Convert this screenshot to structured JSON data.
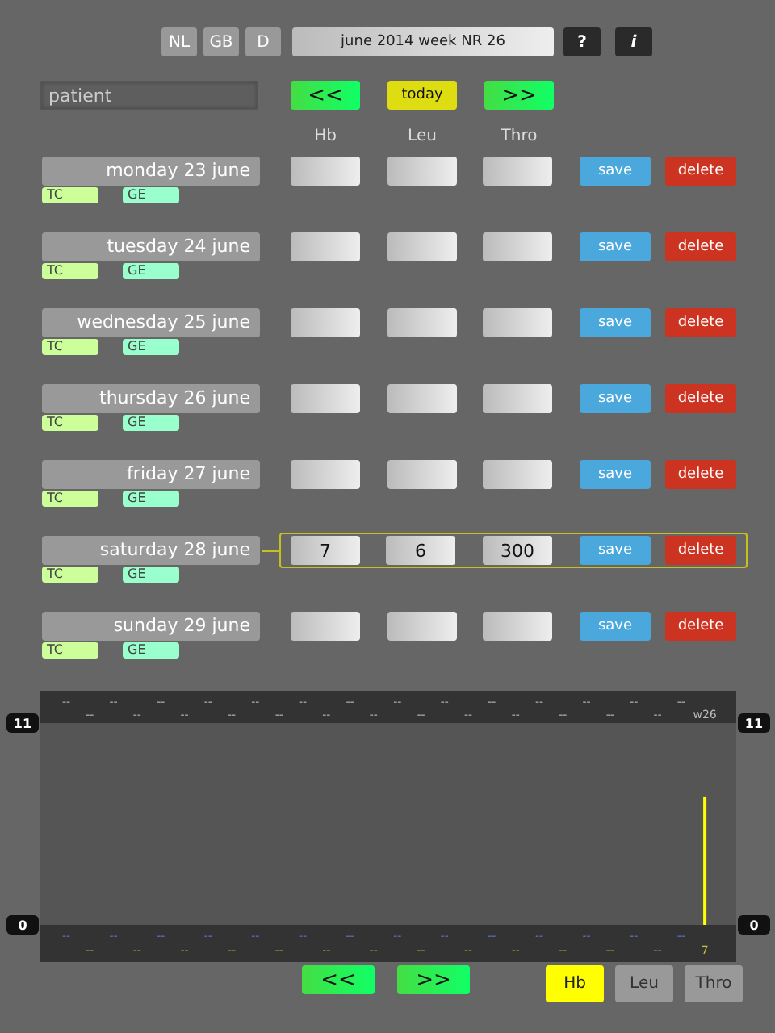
{
  "languages": [
    {
      "label": "NL",
      "selected": false
    },
    {
      "label": "GB",
      "selected": false
    },
    {
      "label": "D",
      "selected": false
    }
  ],
  "period": "june 2014 week NR 26",
  "help_button": "?",
  "info_button": "i",
  "patient": {
    "placeholder": "patient"
  },
  "nav": {
    "prev": "<<",
    "today": "today",
    "next": ">>"
  },
  "columns": [
    "Hb",
    "Leu",
    "Thro"
  ],
  "days": [
    {
      "label": "monday 23 june",
      "selected": false,
      "tags": [
        "TC",
        "GE"
      ],
      "save": "save",
      "delete": "delete"
    },
    {
      "label": "tuesday 24 june",
      "selected": false,
      "tags": [
        "TC",
        "GE"
      ],
      "save": "save",
      "delete": "delete"
    },
    {
      "label": "wednesday 25 june",
      "selected": false,
      "tags": [
        "TC",
        "GE"
      ],
      "save": "save",
      "delete": "delete"
    },
    {
      "label": "thursday 26 june",
      "selected": false,
      "tags": [
        "TC",
        "GE"
      ],
      "save": "save",
      "delete": "delete"
    },
    {
      "label": "friday 27 june",
      "selected": false,
      "tags": [
        "TC",
        "GE"
      ],
      "save": "save",
      "delete": "delete"
    },
    {
      "label": "saturday 28 june",
      "selected": true,
      "values": [
        "7",
        "6",
        "300"
      ],
      "tags": [
        "TC",
        "GE"
      ],
      "save": "save",
      "delete": "delete"
    },
    {
      "label": "sunday 29 june",
      "selected": false,
      "tags": [
        "TC",
        "GE"
      ],
      "save": "save",
      "delete": "delete"
    }
  ],
  "chart": {
    "chart_data": {
      "type": "bar",
      "categories": [
        "--",
        "--",
        "--",
        "--",
        "--",
        "--",
        "--",
        "--",
        "--",
        "--",
        "--",
        "--",
        "--",
        "--",
        "--",
        "--",
        "--",
        "--",
        "--",
        "--",
        "--",
        "--",
        "--",
        "--",
        "--",
        "--",
        "--",
        "w26"
      ],
      "series": [
        {
          "color": "#ffff00",
          "values": [
            null,
            null,
            null,
            null,
            null,
            null,
            null,
            null,
            null,
            null,
            null,
            null,
            null,
            null,
            null,
            null,
            null,
            null,
            null,
            null,
            null,
            null,
            null,
            null,
            null,
            null,
            null,
            7
          ]
        }
      ],
      "value_labels": [
        "--",
        "--",
        "--",
        "--",
        "--",
        "--",
        "--",
        "--",
        "--",
        "--",
        "--",
        "--",
        "--",
        "--",
        "--",
        "--",
        "--",
        "--",
        "--",
        "--",
        "--",
        "--",
        "--",
        "--",
        "--",
        "--",
        "--",
        "7"
      ],
      "ylim": [
        0,
        11
      ],
      "yticks": [
        0,
        11
      ]
    },
    "right_axis_labels": [
      "11",
      "0"
    ]
  },
  "chart_nav": {
    "prev": "<<",
    "next": ">>"
  },
  "series_toggles": [
    {
      "label": "Hb",
      "selected": true
    },
    {
      "label": "Leu",
      "selected": false
    },
    {
      "label": "Thro",
      "selected": false
    }
  ]
}
